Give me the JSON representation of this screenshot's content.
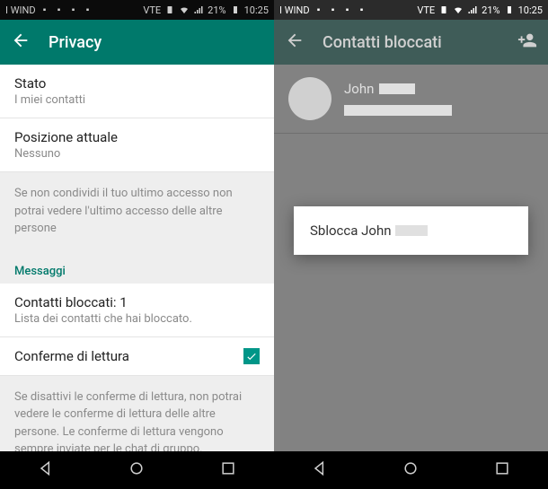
{
  "statusbar": {
    "carrier": "I WIND",
    "battery": "21%",
    "time": "10:25",
    "vte": "VTE"
  },
  "left": {
    "title": "Privacy",
    "stato": {
      "label": "Stato",
      "value": "I miei contatti"
    },
    "posizione": {
      "label": "Posizione attuale",
      "value": "Nessuno"
    },
    "info1": "Se non condividi il tuo ultimo accesso non potrai vedere l'ultimo accesso delle altre persone",
    "section_messaggi": "Messaggi",
    "blocked": {
      "label": "Contatti bloccati: 1",
      "sub": "Lista dei contatti che hai bloccato."
    },
    "read_receipts": {
      "label": "Conferme di lettura",
      "checked": true
    },
    "info2": "Se disattivi le conferme di lettura, non potrai vedere le conferme di lettura delle altre persone. Le conferme di lettura vengono sempre inviate per le chat di gruppo."
  },
  "right": {
    "title": "Contatti bloccati",
    "contact_name": "John",
    "menu_unblock": "Sblocca John"
  }
}
